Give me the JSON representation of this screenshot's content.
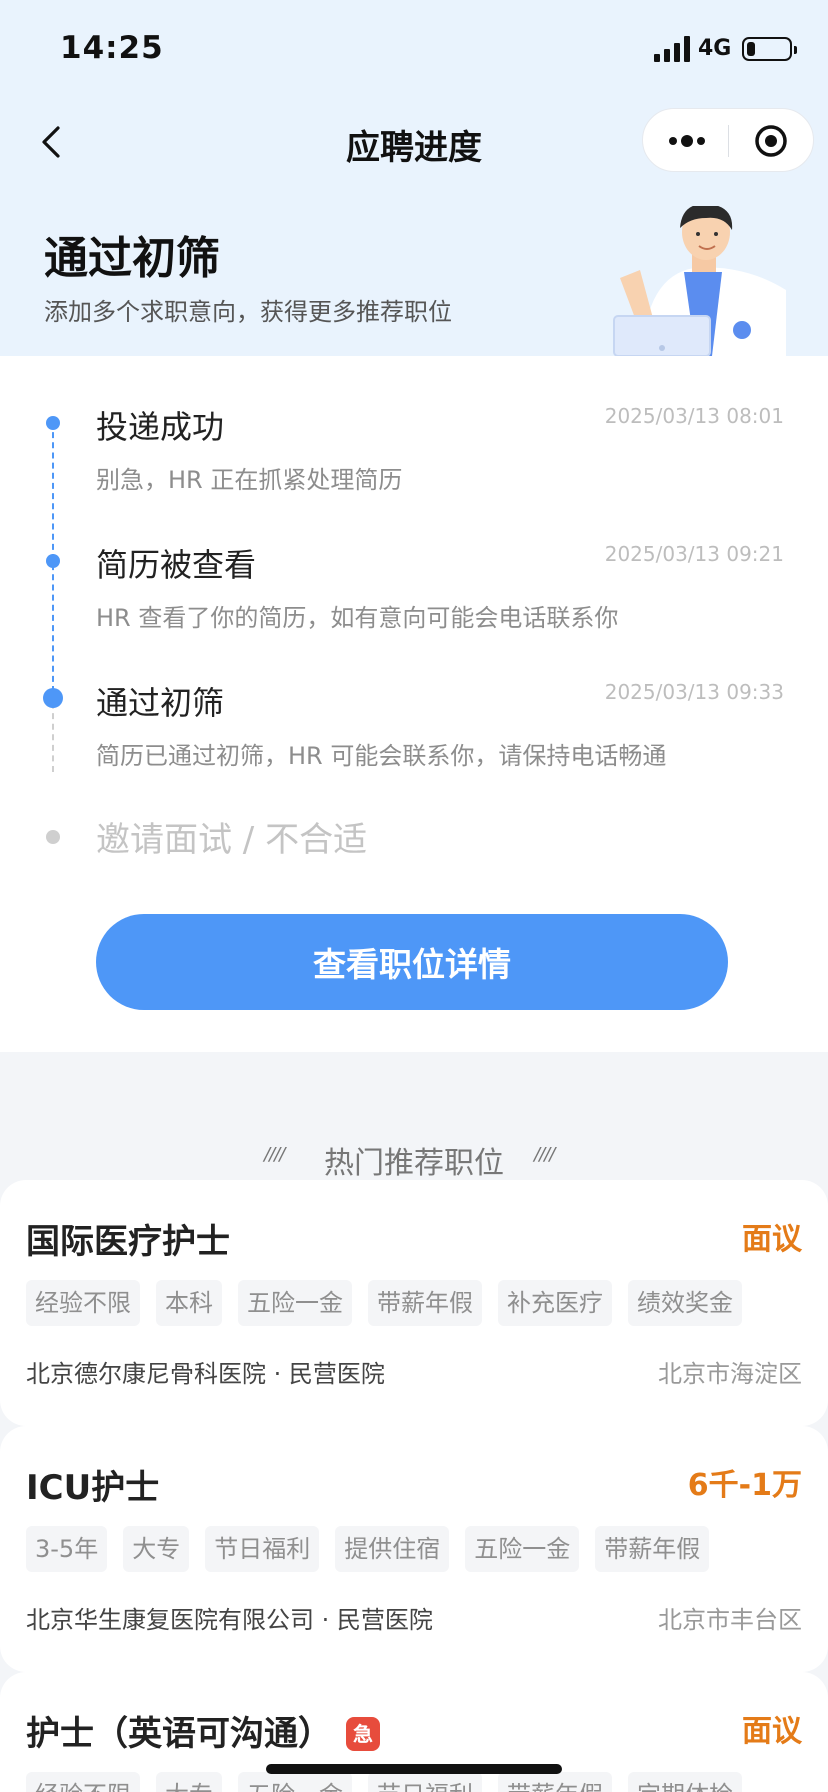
{
  "status_bar": {
    "time": "14:25",
    "network": "4G",
    "battery_level": 0.2
  },
  "nav": {
    "title": "应聘进度"
  },
  "hero": {
    "title": "通过初筛",
    "subtitle": "添加多个求职意向，获得更多推荐职位"
  },
  "progress": {
    "steps": [
      {
        "title": "投递成功",
        "desc": "别急，HR 正在抓紧处理简历",
        "time": "2025/03/13 08:01"
      },
      {
        "title": "简历被查看",
        "desc": "HR 查看了你的简历，如有意向可能会电话联系你",
        "time": "2025/03/13 09:21"
      },
      {
        "title": "通过初筛",
        "desc": "简历已通过初筛，HR 可能会联系你，请保持电话畅通",
        "time": "2025/03/13 09:33"
      }
    ],
    "pending": "邀请面试 / 不合适",
    "button_label": "查看职位详情"
  },
  "recommend": {
    "title": "热门推荐职位",
    "deco_left": "////",
    "deco_right": "////",
    "jobs": [
      {
        "title": "国际医疗护士",
        "salary": "面议",
        "tags": [
          "经验不限",
          "本科",
          "五险一金",
          "带薪年假",
          "补充医疗",
          "绩效奖金"
        ],
        "company": "北京德尔康尼骨科医院 · 民营医院",
        "location": "北京市海淀区"
      },
      {
        "title": "ICU护士",
        "salary": "6千-1万",
        "tags": [
          "3-5年",
          "大专",
          "节日福利",
          "提供住宿",
          "五险一金",
          "带薪年假"
        ],
        "company": "北京华生康复医院有限公司 · 民营医院",
        "location": "北京市丰台区"
      },
      {
        "title": "护士（英语可沟通）",
        "urgent": "急",
        "salary": "面议",
        "tags": [
          "经验不限",
          "大专",
          "五险一金",
          "节日福利",
          "带薪年假",
          "定期体检"
        ]
      }
    ]
  },
  "colors": {
    "accent": "#4e97f7",
    "salary": "#e47b18",
    "urgent": "#e74c3c",
    "hero_bg": "#e9f3fd"
  }
}
